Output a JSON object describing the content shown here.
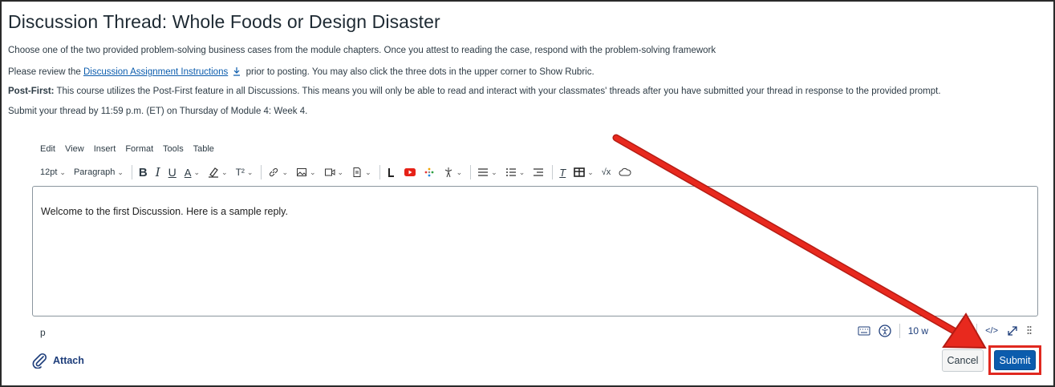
{
  "title": "Discussion Thread: Whole Foods or Design Disaster",
  "paragraphs": {
    "p1": "Choose one of the two provided problem-solving business cases from the module chapters. Once you attest to reading the case, respond with the problem-solving framework",
    "p2_pre": "Please review the ",
    "p2_link": "Discussion Assignment Instructions",
    "p2_post": " prior to posting. You may also click the three dots in the upper corner to Show Rubric.",
    "p3_label": "Post-First:",
    "p3_text": " This course utilizes the Post-First feature in all Discussions. This means you will only be able to read and interact with your classmates' threads after you have submitted your thread in response to the provided prompt.",
    "p4": "Submit your thread by 11:59 p.m. (ET) on Thursday of Module 4: Week 4."
  },
  "editor": {
    "menu": [
      "Edit",
      "View",
      "Insert",
      "Format",
      "Tools",
      "Table"
    ],
    "font_size": "12pt",
    "block_format": "Paragraph",
    "content": "Welcome to the first Discussion. Here is a sample reply.",
    "status_path": "p",
    "word_count": "10 w"
  },
  "actions": {
    "attach_label": "Attach",
    "cancel_label": "Cancel",
    "submit_label": "Submit"
  },
  "colors": {
    "link": "#0b5cad",
    "submit": "#0b5cad",
    "highlight": "#e0281f"
  },
  "icons": {
    "toolbar": [
      "bold-icon",
      "italic-icon",
      "underline-icon",
      "text-color-icon",
      "highlight-icon",
      "superscript-icon",
      "link-icon",
      "image-icon",
      "media-icon",
      "document-icon",
      "apps-icon",
      "youtube-icon",
      "app-icon",
      "accessibility-check-icon",
      "align-icon",
      "list-icon",
      "indent-icon",
      "clear-format-icon",
      "table-icon",
      "equation-icon",
      "cloud-icon"
    ],
    "status": [
      "keyboard-icon",
      "accessibility-icon",
      "html-icon",
      "fullscreen-icon",
      "resize-icon"
    ]
  }
}
